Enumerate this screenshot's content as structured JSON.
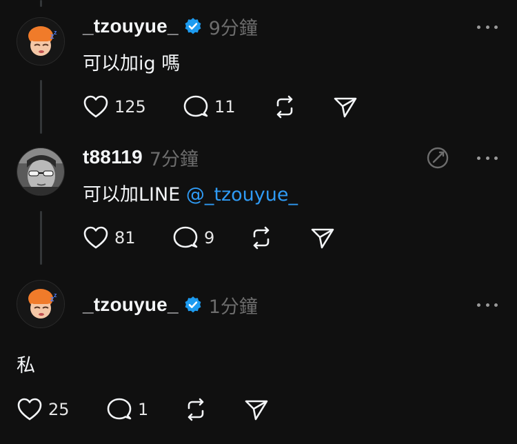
{
  "posts": [
    {
      "username": "_tzouyue_",
      "verified": true,
      "time": "9分鐘",
      "text": "可以加ig 嗎",
      "likes": "125",
      "replies": "11"
    },
    {
      "username": "t88119",
      "verified": false,
      "time": "7分鐘",
      "text": "可以加LINE ",
      "mention": "@_tzouyue_",
      "likes": "81",
      "replies": "9"
    },
    {
      "username": "_tzouyue_",
      "verified": true,
      "time": "1分鐘",
      "text": "私",
      "likes": "25",
      "replies": "1"
    }
  ],
  "icons": {
    "like": "heart-icon",
    "reply": "comment-icon",
    "repost": "repost-icon",
    "share": "send-icon",
    "more": "more-icon",
    "verified": "verified-badge-icon",
    "translate": "translate-icon"
  },
  "colors": {
    "background": "#101010",
    "text": "#f3f5f7",
    "muted": "#6d6d6d",
    "mention": "#2f9bf5",
    "verified": "#1d9bf0"
  }
}
